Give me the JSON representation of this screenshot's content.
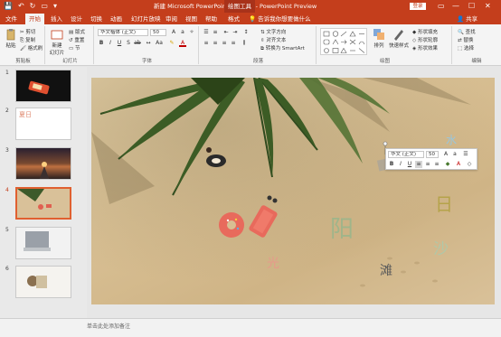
{
  "window": {
    "title": "新建 Microsoft PowerPoint 演示文稿 - PowerPoint Preview",
    "context_tab": "绘图工具",
    "login_label": "登录",
    "controls": [
      "▭",
      "—",
      "☐",
      "✕"
    ]
  },
  "qat": [
    "💾",
    "↶",
    "↻",
    "▭",
    "▾"
  ],
  "tabs": [
    "文件",
    "开始",
    "插入",
    "设计",
    "切换",
    "动画",
    "幻灯片放映",
    "审阅",
    "视图",
    "帮助",
    "格式"
  ],
  "active_tab": "开始",
  "tell_me": "告诉我你想要做什么",
  "share": "共享",
  "ribbon": {
    "clipboard": {
      "label": "剪贴板",
      "paste": "粘贴",
      "cut": "剪切",
      "copy": "复制",
      "format_painter": "格式刷"
    },
    "slides": {
      "label": "幻灯片",
      "new_slide": "新建\n幻灯片",
      "layout": "版式",
      "reset": "重置",
      "section": "节"
    },
    "font": {
      "label": "字体",
      "font_name": "华文楷体 (正文)",
      "font_size": "50"
    },
    "paragraph": {
      "label": "段落",
      "text_direction": "文字方向",
      "align_text": "对齐文本",
      "smartart": "转换为 SmartArt"
    },
    "drawing": {
      "label": "绘图",
      "arrange": "排列",
      "quick_styles": "快速样式",
      "shape_fill": "形状填充",
      "shape_outline": "形状轮廓",
      "shape_effects": "形状效果"
    },
    "editing": {
      "label": "编辑",
      "find": "查找",
      "replace": "替换",
      "select": "选择"
    }
  },
  "thumbnails": [
    {
      "num": "1",
      "kind": "dark"
    },
    {
      "num": "2",
      "kind": "text",
      "text": "夏日"
    },
    {
      "num": "3",
      "kind": "sunset"
    },
    {
      "num": "4",
      "kind": "beach",
      "selected": true
    },
    {
      "num": "5",
      "kind": "laptop"
    },
    {
      "num": "6",
      "kind": "table"
    }
  ],
  "slide": {
    "chars": [
      {
        "text": "阳",
        "color": "#9fb58a"
      },
      {
        "text": "光",
        "color": "#e69a8a"
      },
      {
        "text": "日",
        "color": "#b5a34a"
      },
      {
        "text": "沙",
        "color": "#b0c8a8"
      },
      {
        "text": "滩",
        "color": "#5a5a5a"
      },
      {
        "text": "水",
        "color": "#9ac6dc"
      }
    ]
  },
  "minibar": {
    "font": "华文 (正文)",
    "size": "50"
  },
  "notes_placeholder": "单击此处添加备注"
}
